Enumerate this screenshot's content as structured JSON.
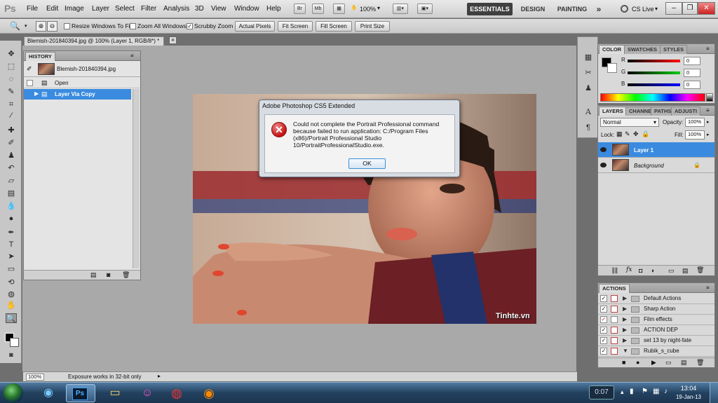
{
  "app": {
    "logo": "Ps"
  },
  "menu": [
    "File",
    "Edit",
    "Image",
    "Layer",
    "Select",
    "Filter",
    "Analysis",
    "3D",
    "View",
    "Window",
    "Help"
  ],
  "appbar": {
    "br": "Br",
    "mb": "Mb",
    "zoom": "100%",
    "zoom_arrow": "▾"
  },
  "workspaces": [
    "ESSENTIALS",
    "DESIGN",
    "PAINTING",
    "»"
  ],
  "cslive": "CS Live",
  "options": {
    "checks": [
      {
        "label": "Resize Windows To Fit",
        "checked": false
      },
      {
        "label": "Zoom All Windows",
        "checked": false
      },
      {
        "label": "Scrubby Zoom",
        "checked": true
      }
    ],
    "buttons": [
      "Actual Pixels",
      "Fit Screen",
      "Fill Screen",
      "Print Size"
    ]
  },
  "document": {
    "tab_title": "Blemish-201840394.jpg @ 100% (Layer 1, RGB/8*) *",
    "close": "×"
  },
  "history": {
    "title": "HISTORY",
    "snapshot": "Blemish-201840394.jpg",
    "items": [
      "Open",
      "Layer Via Copy"
    ]
  },
  "dialog": {
    "title": "Adobe Photoshop CS5 Extended",
    "message": "Could not complete the Portrait Professional command because failed to run application: C:/Program Files (x86)/Portrait Professional Studio 10/PortraitProfessionalStudio.exe.",
    "ok": "OK",
    "icon": "error-icon"
  },
  "watermark": "Tinhte.vn",
  "color_panel": {
    "tabs": [
      "COLOR",
      "SWATCHES",
      "STYLES"
    ],
    "channels": [
      {
        "label": "R",
        "value": "0",
        "color": "#d02020"
      },
      {
        "label": "G",
        "value": "0",
        "color": "#20a020"
      },
      {
        "label": "B",
        "value": "0",
        "color": "#2030c0"
      }
    ]
  },
  "layers_panel": {
    "tabs": [
      "LAYERS",
      "CHANNE",
      "PATHS",
      "ADJUSTI"
    ],
    "blend_mode": "Normal",
    "opacity_label": "Opacity:",
    "opacity": "100%",
    "lock_label": "Lock:",
    "fill_label": "Fill:",
    "fill": "100%",
    "layers": [
      {
        "name": "Layer 1",
        "selected": true
      },
      {
        "name": "Background",
        "selected": false
      }
    ]
  },
  "actions_panel": {
    "title": "ACTIONS",
    "items": [
      {
        "name": "Default Actions",
        "dialog": true
      },
      {
        "name": "Sharp Action",
        "dialog": true
      },
      {
        "name": "Film effects",
        "dialog": false
      },
      {
        "name": "ACTION DEP",
        "dialog": true
      },
      {
        "name": "set 13 by night-fate",
        "dialog": true
      },
      {
        "name": "Rubik_s_cube",
        "dialog": true
      }
    ]
  },
  "status": {
    "zoom": "100%",
    "info": "Exposure works in 32-bit only"
  },
  "taskbar": {
    "clock_time": "13:04",
    "clock_date": "19-Jan-13",
    "meter": "0:07",
    "ps_label": "Ps"
  }
}
